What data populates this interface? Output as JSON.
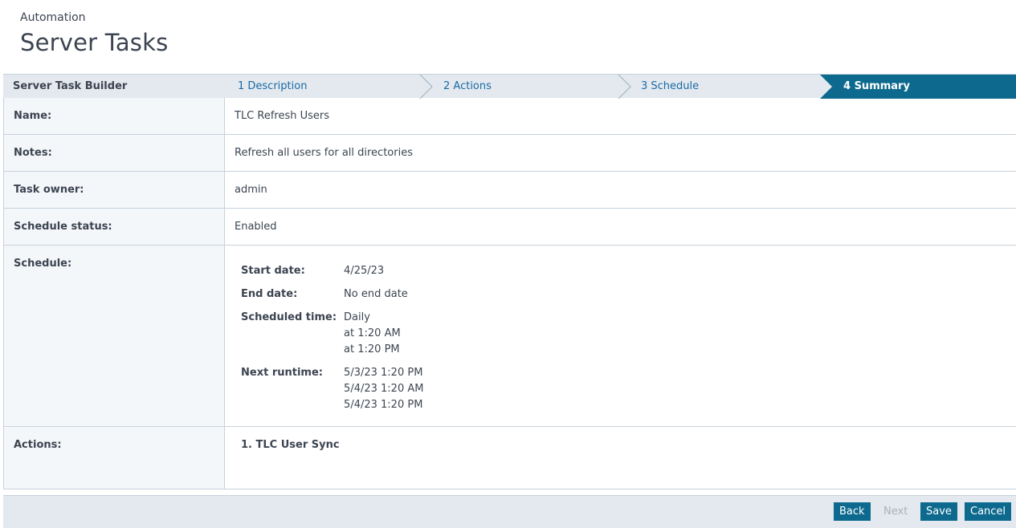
{
  "header": {
    "breadcrumb": "Automation",
    "title": "Server Tasks"
  },
  "wizard": {
    "title": "Server Task Builder",
    "steps": [
      {
        "label": "1 Description",
        "active": false
      },
      {
        "label": "2 Actions",
        "active": false
      },
      {
        "label": "3 Schedule",
        "active": false
      },
      {
        "label": "4 Summary",
        "active": true
      }
    ]
  },
  "summary": {
    "name_label": "Name:",
    "name_value": "TLC Refresh Users",
    "notes_label": "Notes:",
    "notes_value": "Refresh all users for all directories",
    "owner_label": "Task owner:",
    "owner_value": "admin",
    "status_label": "Schedule status:",
    "status_value": "Enabled",
    "schedule_label": "Schedule:",
    "schedule": {
      "start_label": "Start date:",
      "start_value": "4/25/23",
      "end_label": "End date:",
      "end_value": "No end date",
      "time_label": "Scheduled time:",
      "time_lines": [
        "Daily",
        "at 1:20 AM",
        "at 1:20 PM"
      ],
      "next_label": "Next runtime:",
      "next_lines": [
        "5/3/23 1:20 PM",
        "5/4/23 1:20 AM",
        "5/4/23 1:20 PM"
      ]
    },
    "actions_label": "Actions:",
    "actions": [
      "1.  TLC User Sync"
    ]
  },
  "footer": {
    "back": "Back",
    "next": "Next",
    "save": "Save",
    "cancel": "Cancel"
  },
  "colors": {
    "accent": "#0d6a8e",
    "bar": "#e3e9ef",
    "link": "#1b6aa5"
  }
}
